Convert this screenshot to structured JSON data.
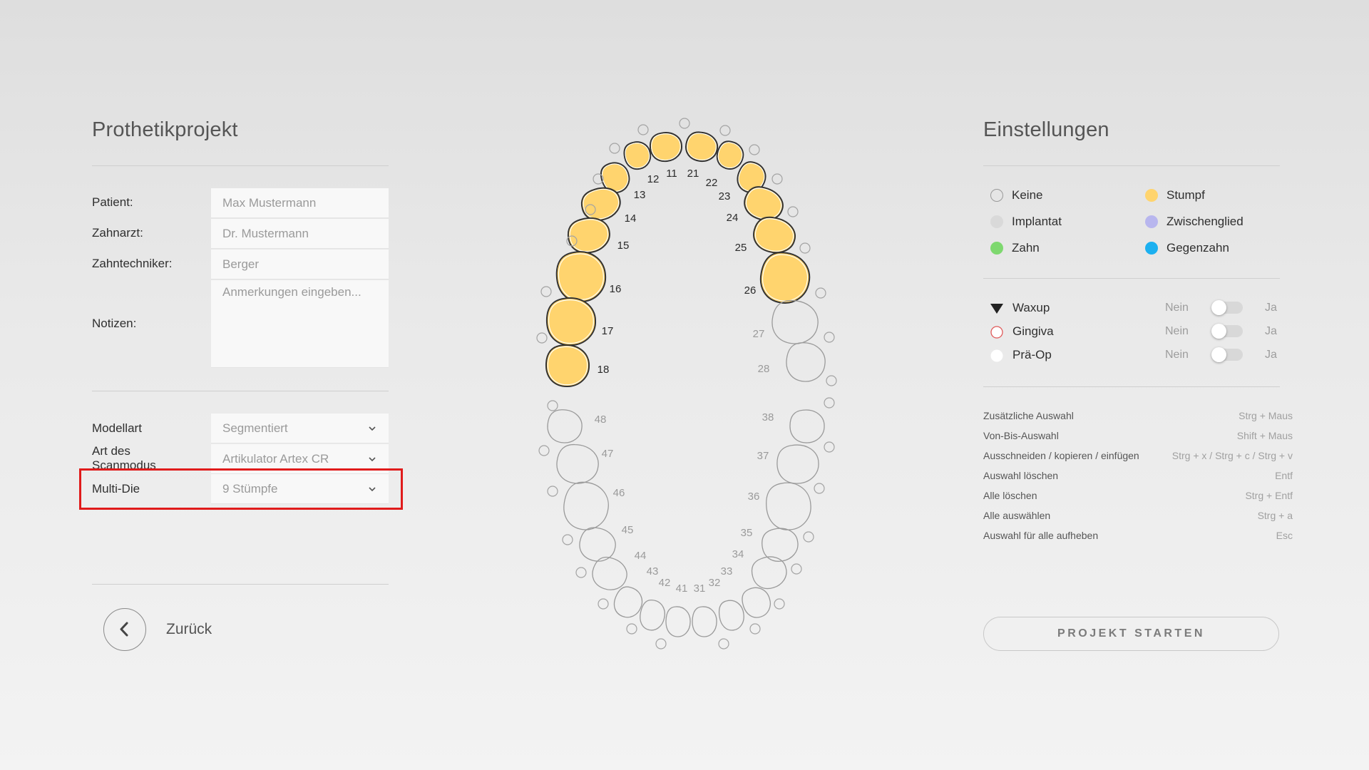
{
  "left_panel": {
    "title": "Prothetikprojekt",
    "fields": [
      {
        "label": "Patient:",
        "value": "Max Mustermann"
      },
      {
        "label": "Zahnarzt:",
        "value": "Dr. Mustermann"
      },
      {
        "label": "Zahntechniker:",
        "value": "Berger"
      }
    ],
    "notes": {
      "label": "Notizen:",
      "placeholder": "Anmerkungen eingeben..."
    },
    "selects": [
      {
        "label": "Modellart",
        "value": "Segmentiert"
      },
      {
        "label": "Art des Scanmodus",
        "value": "Artikulator Artex CR"
      },
      {
        "label": "Multi-Die",
        "value": "9 Stümpfe"
      }
    ],
    "back_label": "Zurück"
  },
  "tooth_chart": {
    "selected_color": "#ffd46e",
    "selected_stroke": "#333333",
    "unselected_stroke": "#9a9a9a",
    "stumpf_teeth": [
      "11",
      "12",
      "13",
      "14",
      "15",
      "16",
      "17",
      "18",
      "21",
      "22",
      "23",
      "24",
      "25",
      "26"
    ],
    "teeth": [
      {
        "id": "11"
      },
      {
        "id": "12"
      },
      {
        "id": "13"
      },
      {
        "id": "14"
      },
      {
        "id": "15"
      },
      {
        "id": "16"
      },
      {
        "id": "17"
      },
      {
        "id": "18"
      },
      {
        "id": "21"
      },
      {
        "id": "22"
      },
      {
        "id": "23"
      },
      {
        "id": "24"
      },
      {
        "id": "25"
      },
      {
        "id": "26"
      },
      {
        "id": "27"
      },
      {
        "id": "28"
      },
      {
        "id": "31"
      },
      {
        "id": "32"
      },
      {
        "id": "33"
      },
      {
        "id": "34"
      },
      {
        "id": "35"
      },
      {
        "id": "36"
      },
      {
        "id": "37"
      },
      {
        "id": "38"
      },
      {
        "id": "41"
      },
      {
        "id": "42"
      },
      {
        "id": "43"
      },
      {
        "id": "44"
      },
      {
        "id": "45"
      },
      {
        "id": "46"
      },
      {
        "id": "47"
      },
      {
        "id": "48"
      }
    ]
  },
  "right_panel": {
    "title": "Einstellungen",
    "legend": [
      {
        "label": "Keine",
        "color": "#ffffff",
        "icon": "circle-outline"
      },
      {
        "label": "Stumpf",
        "color": "#ffd46e",
        "icon": "circle"
      },
      {
        "label": "Implantat",
        "color": "#d9d9d9",
        "icon": "circle"
      },
      {
        "label": "Zwischenglied",
        "color": "#b8b6ee",
        "icon": "circle"
      },
      {
        "label": "Zahn",
        "color": "#7ed86f",
        "icon": "circle"
      },
      {
        "label": "Gegenzahn",
        "color": "#1cb0f0",
        "icon": "circle"
      }
    ],
    "options": [
      {
        "label": "Waxup",
        "icon": "triangle-down-icon",
        "no": "Nein",
        "yes": "Ja",
        "on": false
      },
      {
        "label": "Gingiva",
        "icon": "red-circle-icon",
        "no": "Nein",
        "yes": "Ja",
        "on": false
      },
      {
        "label": "Prä-Op",
        "icon": "white-circle-icon",
        "no": "Nein",
        "yes": "Ja",
        "on": false
      }
    ],
    "shortcuts": [
      {
        "action": "Zusätzliche Auswahl",
        "keys": "Strg + Maus"
      },
      {
        "action": "Von-Bis-Auswahl",
        "keys": "Shift + Maus"
      },
      {
        "action": "Ausschneiden / kopieren / einfügen",
        "keys": "Strg + x / Strg + c / Strg + v"
      },
      {
        "action": "Auswahl löschen",
        "keys": "Entf"
      },
      {
        "action": "Alle löschen",
        "keys": "Strg + Entf"
      },
      {
        "action": "Alle auswählen",
        "keys": "Strg + a"
      },
      {
        "action": "Auswahl für alle aufheben",
        "keys": "Esc"
      }
    ],
    "start_button": "PROJEKT STARTEN"
  }
}
